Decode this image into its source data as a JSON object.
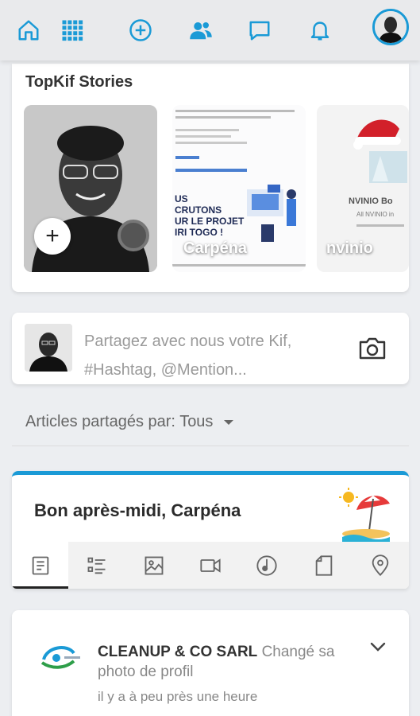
{
  "nav": {
    "icons": [
      "home-icon",
      "grid-icon",
      "add-circle-icon",
      "friends-icon",
      "chat-icon",
      "bell-icon"
    ],
    "accent": "#1a9ad6"
  },
  "stories": {
    "title": "TopKif Stories",
    "items": [
      {
        "name": ""
      },
      {
        "name": "Carpéna"
      },
      {
        "name": "nvinio"
      }
    ],
    "story3_heading": "NVINIO Bo",
    "story3_sub": "All NVINIO in",
    "story2_text": "US\nCRUTONS\nUR LE PROJET\nIRI TOGO !"
  },
  "composer": {
    "placeholder": "Partagez avec nous votre Kif, #Hashtag, @Mention..."
  },
  "filter": {
    "label": "Articles partagés par:",
    "value": "Tous"
  },
  "greeting": {
    "text": "Bon après-midi, Carpéna",
    "tabs": [
      "article-icon",
      "list-icon",
      "image-icon",
      "video-icon",
      "music-icon",
      "document-icon",
      "location-icon"
    ]
  },
  "post": {
    "author": "CLEANUP & CO SARL",
    "action": "Changé sa photo de profil",
    "time": "il y a à peu près une heure"
  }
}
